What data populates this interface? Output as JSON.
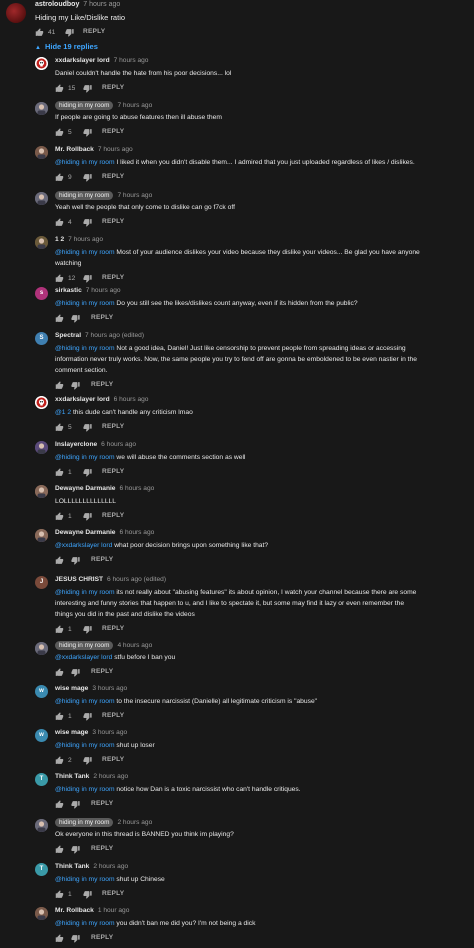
{
  "top_comment": {
    "author": "astroloudboy",
    "time": "7 hours ago",
    "text": "Hiding my Like/Dislike ratio",
    "likes": "41",
    "reply_label": "REPLY",
    "hide_replies_label": "Hide 19 replies"
  },
  "replies": [
    {
      "author": "xxdarkslayer lord",
      "pill": false,
      "time": "7 hours ago",
      "avatar_color": "#ffffff",
      "avatar_letter": "",
      "avatar_icon": "skull-logo",
      "lines": [
        {
          "mention": "",
          "text": "Daniel couldn't handle the hate from his poor decisions... lol"
        }
      ],
      "likes": "15",
      "reply_label": "REPLY"
    },
    {
      "author": "hiding in my room",
      "pill": true,
      "time": "7 hours ago",
      "avatar_color": "#6a6a7a",
      "avatar_letter": "",
      "avatar_icon": "anime-avatar",
      "lines": [
        {
          "mention": "",
          "text": "If people are going to abuse features then ill abuse them"
        }
      ],
      "likes": "5",
      "reply_label": "REPLY"
    },
    {
      "author": "Mr. Rollback",
      "pill": false,
      "time": "7 hours ago",
      "avatar_color": "#7a5a4a",
      "avatar_letter": "",
      "avatar_icon": "character-avatar",
      "lines": [
        {
          "mention": "@hiding in my room",
          "text": " I liked it when you didn't disable them... I admired that you just uploaded regardless of likes / dislikes."
        }
      ],
      "likes": "9",
      "reply_label": "REPLY"
    },
    {
      "author": "hiding in my room",
      "pill": true,
      "time": "7 hours ago",
      "avatar_color": "#6a6a7a",
      "avatar_letter": "",
      "avatar_icon": "anime-avatar",
      "lines": [
        {
          "mention": "",
          "text": "Yeah well the people that only come to dislike can go f7ck off"
        }
      ],
      "likes": "4",
      "reply_label": "REPLY"
    },
    {
      "author": "1 2",
      "pill": false,
      "time": "7 hours ago",
      "avatar_color": "#6b5a3a",
      "avatar_letter": "",
      "avatar_icon": "photo-avatar",
      "lines": [
        {
          "mention": "@hiding in my room",
          "text": " Most of your audience dislikes your video because they dislike your videos... Be glad you have anyone"
        },
        {
          "mention": "",
          "text": "watching"
        }
      ],
      "likes": "12",
      "reply_label": "REPLY"
    },
    {
      "author": "sirkastic",
      "pill": false,
      "time": "7 hours ago",
      "avatar_color": "#b0327a",
      "avatar_letter": "s",
      "avatar_icon": "",
      "lines": [
        {
          "mention": "@hiding in my room",
          "text": " Do you still see the likes/dislikes count anyway, even if its hidden from the public?"
        }
      ],
      "likes": "",
      "reply_label": "REPLY"
    },
    {
      "author": "Spectral",
      "pill": false,
      "time": "7 hours ago (edited)",
      "avatar_color": "#3f7fb0",
      "avatar_letter": "S",
      "avatar_icon": "",
      "lines": [
        {
          "mention": "@hiding in my room",
          "text": " Not a good idea, Daniel! Just like censorship to prevent people from spreading ideas or accessing"
        },
        {
          "mention": "",
          "text": "information never truly works. Now, the same people you try to fend off are gonna be emboldened to be even nastier in the"
        },
        {
          "mention": "",
          "text": "comment section."
        }
      ],
      "likes": "",
      "reply_label": "REPLY"
    },
    {
      "author": "xxdarkslayer lord",
      "pill": false,
      "time": "6 hours ago",
      "avatar_color": "#ffffff",
      "avatar_letter": "",
      "avatar_icon": "skull-logo",
      "lines": [
        {
          "mention": "@1 2",
          "text": " this dude can't handle any criticism lmao"
        }
      ],
      "likes": "5",
      "reply_label": "REPLY"
    },
    {
      "author": "Inslayerclone",
      "pill": false,
      "time": "6 hours ago",
      "avatar_color": "#5a4a7a",
      "avatar_letter": "",
      "avatar_icon": "pixel-avatar",
      "lines": [
        {
          "mention": "@hiding in my room",
          "text": " we will abuse the comments section as well"
        }
      ],
      "likes": "1",
      "reply_label": "REPLY"
    },
    {
      "author": "Dewayne Darmanie",
      "pill": false,
      "time": "6 hours ago",
      "avatar_color": "#8a6a5a",
      "avatar_letter": "",
      "avatar_icon": "face-avatar",
      "lines": [
        {
          "mention": "",
          "text": "LOLLLLLLLLLLLLLL"
        }
      ],
      "likes": "1",
      "reply_label": "REPLY"
    },
    {
      "author": "Dewayne Darmanie",
      "pill": false,
      "time": "6 hours ago",
      "avatar_color": "#8a6a5a",
      "avatar_letter": "",
      "avatar_icon": "face-avatar",
      "lines": [
        {
          "mention": "@xxdarkslayer lord",
          "text": "  what poor decision brings upon something like that?"
        }
      ],
      "likes": "",
      "reply_label": "REPLY"
    },
    {
      "author": "JESUS CHRIST",
      "pill": false,
      "time": "6 hours ago (edited)",
      "avatar_color": "#7a4a3a",
      "avatar_letter": "J",
      "avatar_icon": "",
      "lines": [
        {
          "mention": "@hiding in my room",
          "text": "  its not really about \"abusing features\" its about opinion, I watch your channel because there are some"
        },
        {
          "mention": "",
          "text": "interesting and funny stories that happen to u, and I like to spectate it, but some may find it lazy or even remember the"
        },
        {
          "mention": "",
          "text": "things you did in the past and dislike the videos"
        }
      ],
      "likes": "1",
      "reply_label": "REPLY"
    },
    {
      "author": "hiding in my room",
      "pill": true,
      "time": "4 hours ago",
      "avatar_color": "#6a6a7a",
      "avatar_letter": "",
      "avatar_icon": "anime-avatar",
      "lines": [
        {
          "mention": "@xxdarkslayer lord",
          "text": " stfu before I ban you"
        }
      ],
      "likes": "",
      "reply_label": "REPLY"
    },
    {
      "author": "wise mage",
      "pill": false,
      "time": "3 hours ago",
      "avatar_color": "#3a8ab0",
      "avatar_letter": "w",
      "avatar_icon": "",
      "lines": [
        {
          "mention": "@hiding in my room",
          "text": " to the insecure narcissist (Danielle) all legitimate criticism is \"abuse\""
        }
      ],
      "likes": "1",
      "reply_label": "REPLY"
    },
    {
      "author": "wise mage",
      "pill": false,
      "time": "3 hours ago",
      "avatar_color": "#3a8ab0",
      "avatar_letter": "w",
      "avatar_icon": "",
      "lines": [
        {
          "mention": "@hiding in my room",
          "text": " shut up loser"
        }
      ],
      "likes": "2",
      "reply_label": "REPLY"
    },
    {
      "author": "Think Tank",
      "pill": false,
      "time": "2 hours ago",
      "avatar_color": "#3a9aa8",
      "avatar_letter": "T",
      "avatar_icon": "",
      "lines": [
        {
          "mention": "@hiding in my room",
          "text": " notice how Dan is a toxic narcissist who can't handle critiques."
        }
      ],
      "likes": "",
      "reply_label": "REPLY"
    },
    {
      "author": "hiding in my room",
      "pill": true,
      "time": "2 hours ago",
      "avatar_color": "#6a6a7a",
      "avatar_letter": "",
      "avatar_icon": "anime-avatar",
      "lines": [
        {
          "mention": "",
          "text": "Ok everyone in this thread is BANNED you think im playing?"
        }
      ],
      "likes": "",
      "reply_label": "REPLY"
    },
    {
      "author": "Think Tank",
      "pill": false,
      "time": "2 hours ago",
      "avatar_color": "#3a9aa8",
      "avatar_letter": "T",
      "avatar_icon": "",
      "lines": [
        {
          "mention": "@hiding in my room",
          "text": " shut up Chinese"
        }
      ],
      "likes": "1",
      "reply_label": "REPLY"
    },
    {
      "author": "Mr. Rollback",
      "pill": false,
      "time": "1 hour ago",
      "avatar_color": "#7a5a4a",
      "avatar_letter": "",
      "avatar_icon": "character-avatar",
      "lines": [
        {
          "mention": "@hiding in my room",
          "text": " you didn't ban me did you? I'm not being a dick"
        }
      ],
      "likes": "",
      "reply_label": "REPLY"
    }
  ]
}
